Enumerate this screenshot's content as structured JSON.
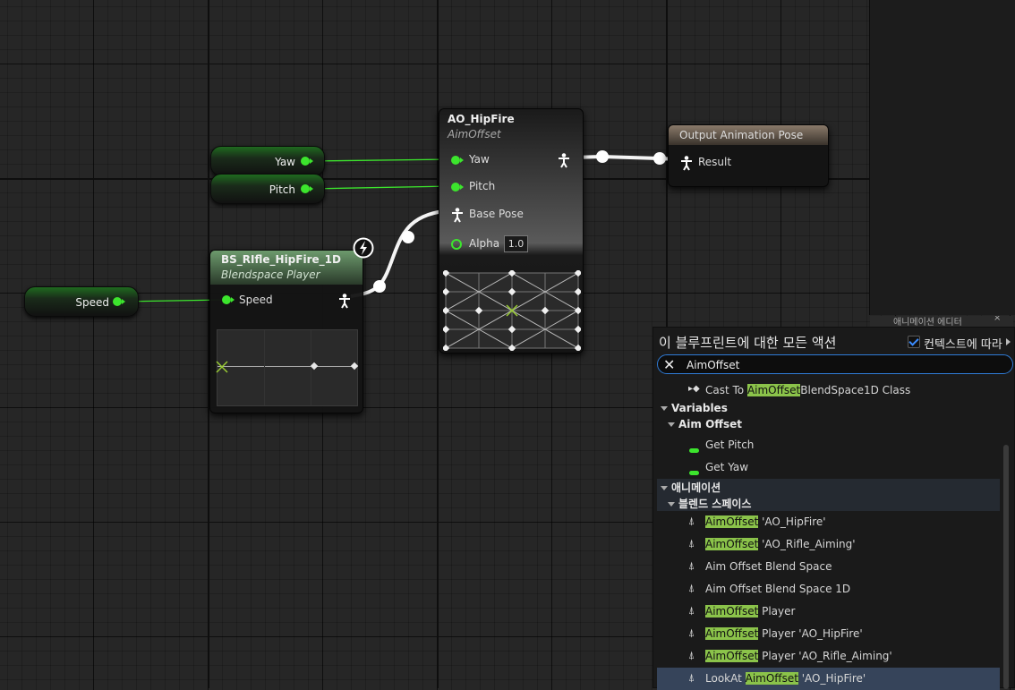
{
  "graph": {
    "var_nodes": [
      {
        "label": "Yaw"
      },
      {
        "label": "Pitch"
      },
      {
        "label": "Speed"
      }
    ],
    "blendspace": {
      "title": "BS_RIfle_HipFire_1D",
      "subtitle": "Blendspace Player",
      "input_pin": "Speed"
    },
    "aimoffset": {
      "title": "AO_HipFire",
      "subtitle": "AimOffset",
      "pins": [
        "Yaw",
        "Pitch",
        "Base Pose",
        "Alpha"
      ],
      "alpha_value": "1.0"
    },
    "output": {
      "title": "Output Animation Pose",
      "pin": "Result"
    }
  },
  "panel_tab": "애니메이션 에디터",
  "action_menu": {
    "header": "이 블루프린트에 대한 모든 액션",
    "context_label": "컨텍스트에 따라",
    "context_checked": true,
    "search_value": "AimOffset",
    "items": [
      {
        "prefix": "Cast To ",
        "hl": "AimOffset",
        "suffix": "BlendSpace1D Class",
        "icon": "cast-icon"
      },
      {
        "category": "Variables"
      },
      {
        "subcategory": "Aim Offset"
      },
      {
        "prefix": "Get Pitch",
        "hl": "",
        "suffix": "",
        "icon": "variable-icon"
      },
      {
        "prefix": "Get Yaw",
        "hl": "",
        "suffix": "",
        "icon": "variable-icon"
      },
      {
        "category": "애니메이션"
      },
      {
        "subcategory": "블렌드 스페이스"
      },
      {
        "prefix": "",
        "hl": "AimOffset",
        "suffix": " 'AO_HipFire'",
        "icon": "animation-icon"
      },
      {
        "prefix": "",
        "hl": "AimOffset",
        "suffix": " 'AO_Rifle_Aiming'",
        "icon": "animation-icon"
      },
      {
        "prefix": "Aim Offset Blend Space",
        "hl": "",
        "suffix": "",
        "icon": "animation-icon"
      },
      {
        "prefix": "Aim Offset Blend Space 1D",
        "hl": "",
        "suffix": "",
        "icon": "animation-icon"
      },
      {
        "prefix": "",
        "hl": "AimOffset",
        "suffix": " Player",
        "icon": "animation-icon"
      },
      {
        "prefix": "",
        "hl": "AimOffset",
        "suffix": " Player 'AO_HipFire'",
        "icon": "animation-icon"
      },
      {
        "prefix": "",
        "hl": "AimOffset",
        "suffix": " Player 'AO_Rifle_Aiming'",
        "icon": "animation-icon"
      },
      {
        "prefix": "LookAt ",
        "hl": "AimOffset",
        "suffix": " 'AO_HipFire'",
        "icon": "animation-icon"
      }
    ]
  },
  "colors": {
    "exec_pin": "#3ce52d",
    "highlight": "#8bc34a",
    "search_border": "#2f7bd6",
    "selected_row": "#36445a"
  }
}
